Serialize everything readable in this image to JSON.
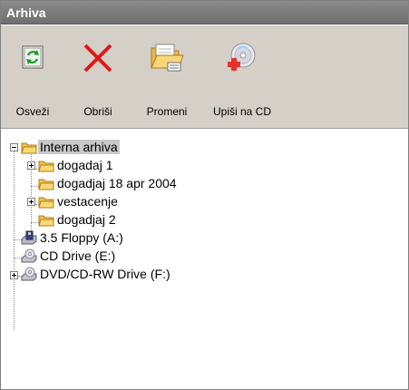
{
  "window": {
    "title": "Arhiva"
  },
  "toolbar": {
    "refresh_label": "Osveži",
    "delete_label": "Obriši",
    "change_label": "Promeni",
    "burn_label": "Upiši na CD"
  },
  "tree": {
    "root": "Interna arhiva",
    "folders": [
      "dogadaj 1",
      "dogadjaj 18 apr 2004",
      "vestacenje",
      "dogadjaj 2"
    ],
    "drives": [
      "3.5 Floppy (A:)",
      "CD Drive (E:)",
      "DVD/CD-RW Drive (F:)"
    ]
  },
  "colors": {
    "title_bar": "#7a7a7a",
    "toolbar_bg": "#d4d0c8",
    "delete_x": "#e0161a",
    "selection": "#c8c8c8"
  }
}
